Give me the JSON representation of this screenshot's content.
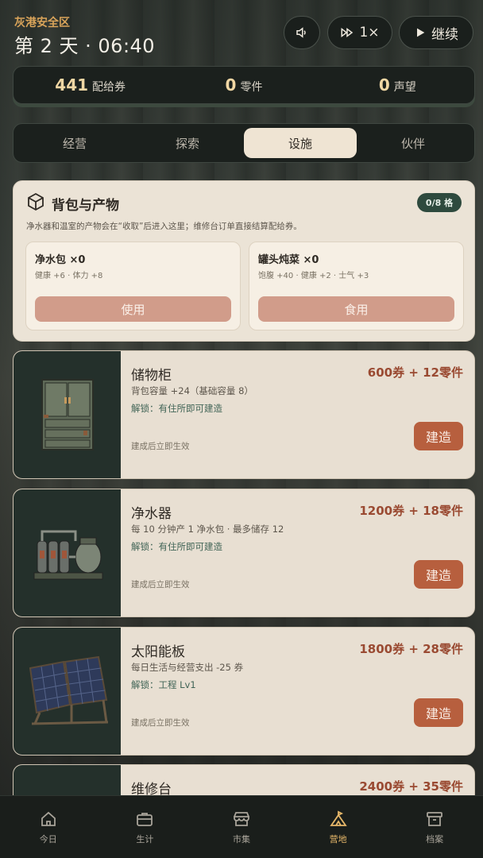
{
  "header": {
    "zone": "灰港安全区",
    "day_time": "第 2 天 · 06:40",
    "speed_label": "1×",
    "resume_label": "继续"
  },
  "resources": [
    {
      "value": "441",
      "label": "配给券"
    },
    {
      "value": "0",
      "label": "零件"
    },
    {
      "value": "0",
      "label": "声望"
    }
  ],
  "tabs": [
    {
      "label": "经营",
      "active": false
    },
    {
      "label": "探索",
      "active": false
    },
    {
      "label": "设施",
      "active": true
    },
    {
      "label": "伙伴",
      "active": false
    }
  ],
  "backpack": {
    "title": "背包与产物",
    "badge": "0/8 格",
    "description": "净水器和温室的产物会在“收取”后进入这里；维修台订单直接结算配给券。",
    "items": [
      {
        "name": "净水包 ×0",
        "effect": "健康 +6 · 体力 +8",
        "action": "使用"
      },
      {
        "name": "罐头炖菜 ×0",
        "effect": "饱腹 +40 · 健康 +2 · 士气 +3",
        "action": "食用"
      }
    ]
  },
  "facilities": [
    {
      "name": "储物柜",
      "cost": "600券 + 12零件",
      "effect": "背包容量 +24（基础容量 8）",
      "unlock": "解锁：有住所即可建造",
      "note": "建成后立即生效",
      "action": "建造"
    },
    {
      "name": "净水器",
      "cost": "1200券 + 18零件",
      "effect": "每 10 分钟产 1 净水包 · 最多储存 12",
      "unlock": "解锁：有住所即可建造",
      "note": "建成后立即生效",
      "action": "建造"
    },
    {
      "name": "太阳能板",
      "cost": "1800券 + 28零件",
      "effect": "每日生活与经营支出 -25 券",
      "unlock": "解锁：工程 Lv1",
      "note": "建成后立即生效",
      "action": "建造"
    },
    {
      "name": "维修台",
      "cost": "2400券 + 35零件"
    }
  ],
  "nav": [
    {
      "label": "今日",
      "icon": "home-icon",
      "active": false
    },
    {
      "label": "生计",
      "icon": "briefcase-icon",
      "active": false
    },
    {
      "label": "市集",
      "icon": "store-icon",
      "active": false
    },
    {
      "label": "营地",
      "icon": "camp-icon",
      "active": true
    },
    {
      "label": "档案",
      "icon": "archive-icon",
      "active": false
    }
  ],
  "colors": {
    "accent": "#e7b86a",
    "cost": "#9a4a32",
    "build_button": "#b75f3e",
    "badge": "#2e4a3e"
  }
}
